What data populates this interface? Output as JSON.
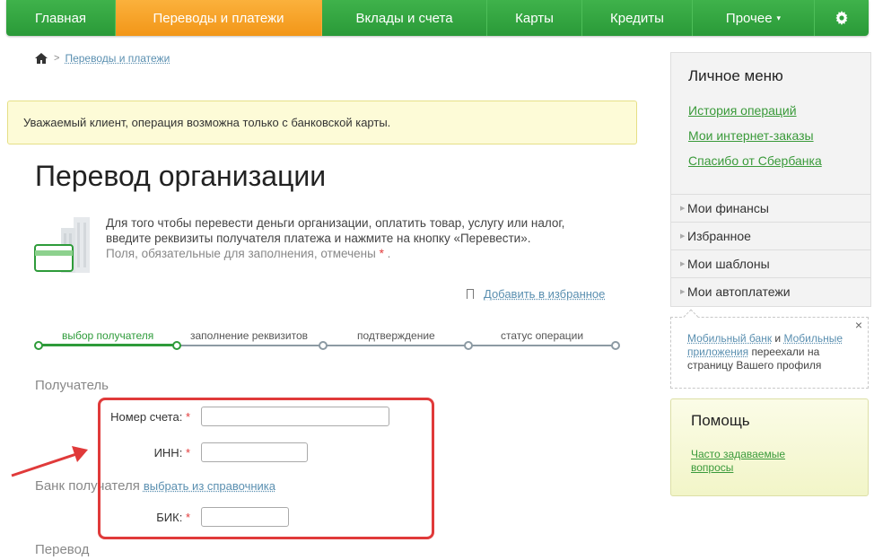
{
  "nav": {
    "items": [
      {
        "label": "Главная"
      },
      {
        "label": "Переводы и платежи"
      },
      {
        "label": "Вклады и счета"
      },
      {
        "label": "Карты"
      },
      {
        "label": "Кредиты"
      },
      {
        "label": "Прочее"
      }
    ],
    "active_index": 1,
    "settings_icon": "gear-icon"
  },
  "breadcrumb": {
    "home_icon": "home-icon",
    "current": "Переводы и платежи"
  },
  "notice": {
    "text": "Уважаемый клиент, операция возможна только с банковской карты."
  },
  "page": {
    "title": "Перевод организации",
    "intro_line1": "Для того чтобы перевести деньги организации, оплатить товар, услугу или налог,",
    "intro_line2": "введите реквизиты получателя платежа и нажмите на кнопку «Перевести».",
    "required_note": "Поля, обязательные для заполнения, отмечены",
    "required_mark": "*",
    "required_end": ".",
    "add_favorite": "Добавить в избранное"
  },
  "steps": {
    "items": [
      {
        "label": "выбор получателя"
      },
      {
        "label": "заполнение реквизитов"
      },
      {
        "label": "подтверждение"
      },
      {
        "label": "статус операции"
      }
    ],
    "current_index": 0
  },
  "form": {
    "recipient_section": "Получатель",
    "account_label": "Номер счета:",
    "account_value": "",
    "inn_label": "ИНН:",
    "inn_value": "",
    "bank_section": "Банк получателя",
    "bank_link": "выбрать из справочника",
    "bik_label": "БИК:",
    "bik_value": "",
    "transfer_section": "Перевод",
    "required_mark": "*"
  },
  "sidebar": {
    "title": "Личное меню",
    "links": [
      {
        "label": "История операций"
      },
      {
        "label": "Мои интернет-заказы"
      },
      {
        "label": "Спасибо от Сбербанка"
      }
    ],
    "rows": [
      {
        "label": "Мои финансы"
      },
      {
        "label": "Избранное"
      },
      {
        "label": "Мои шаблоны"
      },
      {
        "label": "Мои автоплатежи"
      }
    ],
    "note": {
      "link1": "Мобильный банк",
      "conj": "и",
      "link2": "Мобильные приложения",
      "text": "переехали на страницу Вашего профиля",
      "close": "×"
    },
    "help": {
      "title": "Помощь",
      "link": "Часто задаваемые вопросы"
    }
  },
  "colors": {
    "nav_green": "#2a9a38",
    "nav_active_orange": "#f29618",
    "link_green": "#3a9a3a",
    "highlight_red": "#e03a3a",
    "notice_yellow": "#fdfbd7"
  }
}
